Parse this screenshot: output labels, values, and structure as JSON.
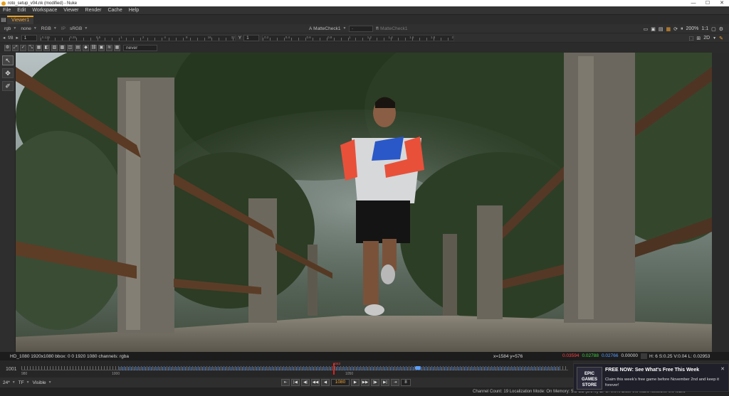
{
  "window": {
    "title": "roto_setup_v04.nk (modified) - Nuke",
    "controls": [
      "—",
      "☐",
      "✕"
    ]
  },
  "menu": [
    "File",
    "Edit",
    "Workspace",
    "Viewer",
    "Render",
    "Cache",
    "Help"
  ],
  "tabs": [
    {
      "label": "Viewer1"
    }
  ],
  "viewer_toolbar": {
    "channels": "rgb",
    "alpha": "none",
    "display": "RGB",
    "lut_label": "IP",
    "colorspace": "sRGB",
    "input_a_label": "A",
    "input_a": "MatteCheck1",
    "composite": "-",
    "input_b_label": "B",
    "input_b": "MatteCheck1",
    "zoom": "200%",
    "ratio": "1:1",
    "fstop": "f/8",
    "gain_value": "1",
    "y_label": "Y",
    "gamma_value": "1",
    "view_mode": "2D",
    "clip_mode": "never",
    "gain_ticks": [
      "0.125",
      "0.25",
      "0.5",
      "1",
      "2",
      "4",
      "8",
      "16",
      "32"
    ],
    "gamma_ticks": [
      "0.2",
      "0.4",
      "0.6",
      "0.8",
      "1",
      "1.2",
      "1.4",
      "1.6",
      "1.8",
      "2"
    ]
  },
  "tools": [
    "select-arrow",
    "transform",
    "curve"
  ],
  "info_bar": {
    "format": "HD_1080 1920x1080  bbox: 0 0 1920 1080 channels: rgba",
    "coords": "x=1584 y=576",
    "r": "0.03594",
    "g": "0.02788",
    "b": "0.02766",
    "a": "0.00000",
    "hsvl": "H:   6 S:0.25 V:0.04  L: 0.02953",
    "colors": {
      "r": "#ff4040",
      "g": "#40d040",
      "b": "#5aa0ff"
    }
  },
  "timeline": {
    "start_frame": "1001",
    "current_frame": "1043",
    "label_980": "980",
    "label_1000": "1000",
    "label_1050": "1050"
  },
  "playback": {
    "fps": "24*",
    "tf": "TF",
    "range": "Visible",
    "frame": "1080",
    "increment": "8",
    "buttons": [
      "⇤",
      "|◀",
      "◀|",
      "◀◀",
      "◀",
      "▶",
      "▶▶",
      "|▶",
      "▶|",
      "⇥"
    ]
  },
  "status": "Channel Count: 19  Localization Mode: On  Memory: 5.5 GB (5.9%)  CPU: 0.0%  Disk: 0.0 MB/s  Network: 0.0 MB/s",
  "notification": {
    "logo": "EPIC GAMES STORE",
    "title": "FREE NOW: See What's Free This Week",
    "body": "Claim this week's free game before November 2nd and keep it forever!",
    "close": "✕"
  }
}
